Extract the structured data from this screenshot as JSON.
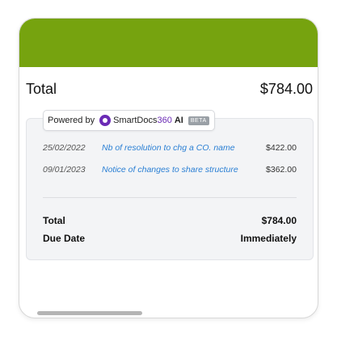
{
  "colors": {
    "header": "#76a30f",
    "link": "#2a7fd4",
    "brand": "#6b2bb5"
  },
  "summary": {
    "label": "Total",
    "amount": "$784.00"
  },
  "powered": {
    "prefix": "Powered by",
    "brand_main": "SmartDocs",
    "brand_num": "360",
    "brand_ai": "AI",
    "badge": "BETA"
  },
  "items": [
    {
      "date": "25/02/2022",
      "description": "Nb of resolution to chg a CO. name",
      "amount": "$422.00"
    },
    {
      "date": "09/01/2023",
      "description": "Notice of changes to share structure",
      "amount": "$362.00"
    }
  ],
  "totals": [
    {
      "label": "Total",
      "value": "$784.00"
    },
    {
      "label": "Due Date",
      "value": "Immediately"
    }
  ]
}
